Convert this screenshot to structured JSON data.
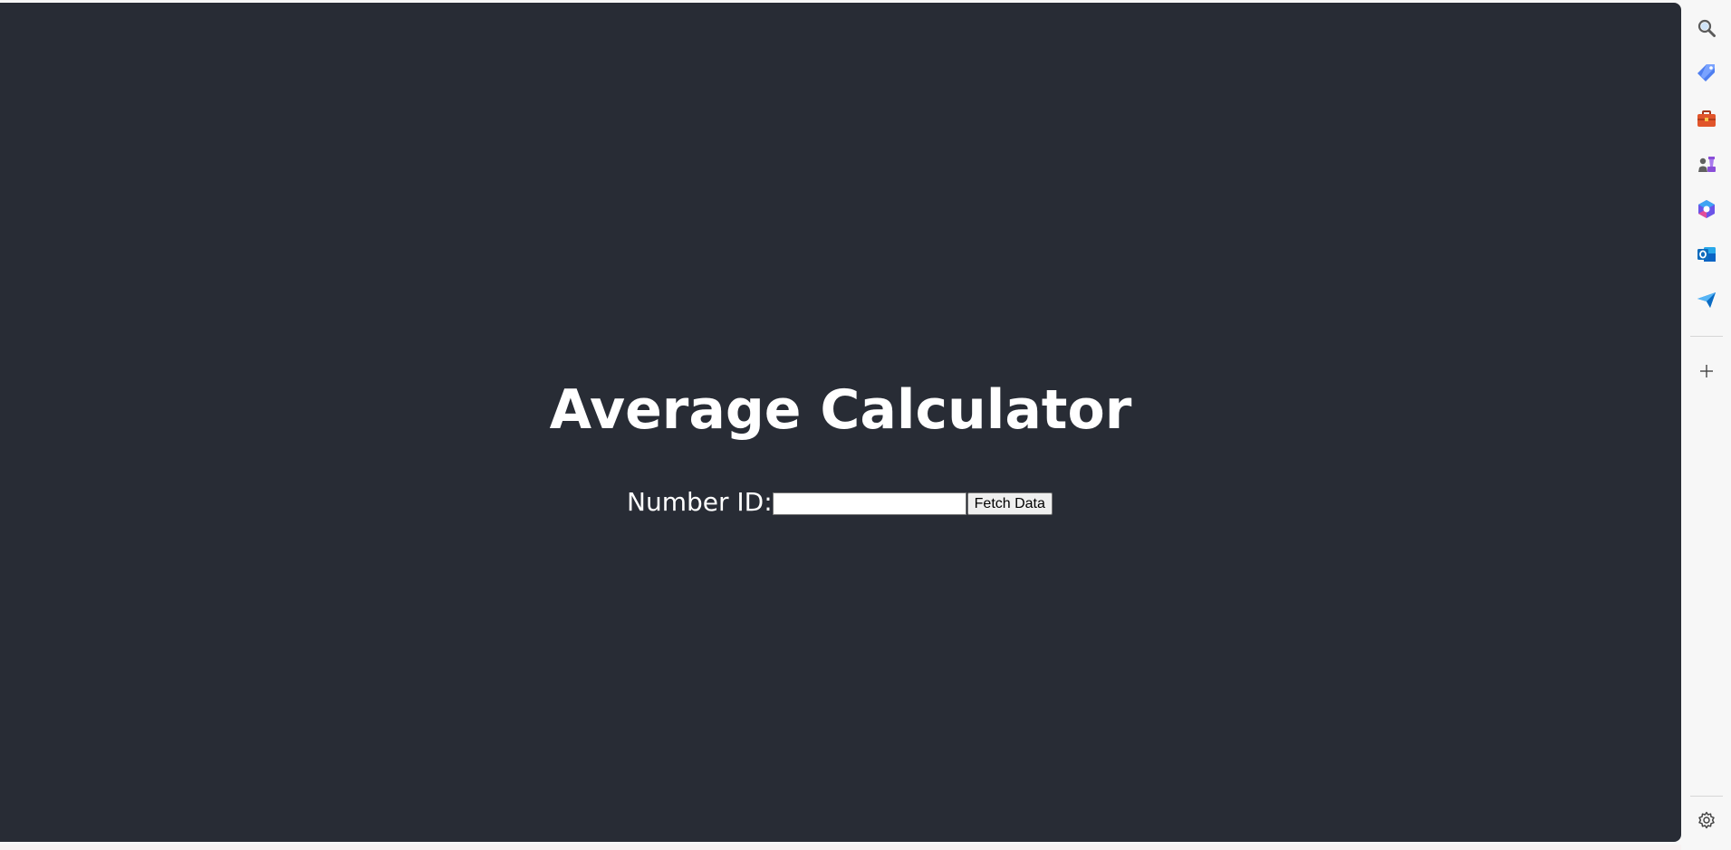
{
  "app": {
    "title": "Average Calculator"
  },
  "form": {
    "label": "Number ID:",
    "input_value": "",
    "button_label": "Fetch Data"
  },
  "sidebar": {
    "icons": [
      {
        "name": "search-icon"
      },
      {
        "name": "shopping-tag-icon"
      },
      {
        "name": "toolbox-icon"
      },
      {
        "name": "games-icon"
      },
      {
        "name": "copilot-icon"
      },
      {
        "name": "outlook-icon"
      },
      {
        "name": "send-icon"
      },
      {
        "name": "add-icon"
      },
      {
        "name": "settings-icon"
      }
    ]
  },
  "colors": {
    "background": "#282c35",
    "text": "#ffffff",
    "rail": "#f7f7f7"
  }
}
